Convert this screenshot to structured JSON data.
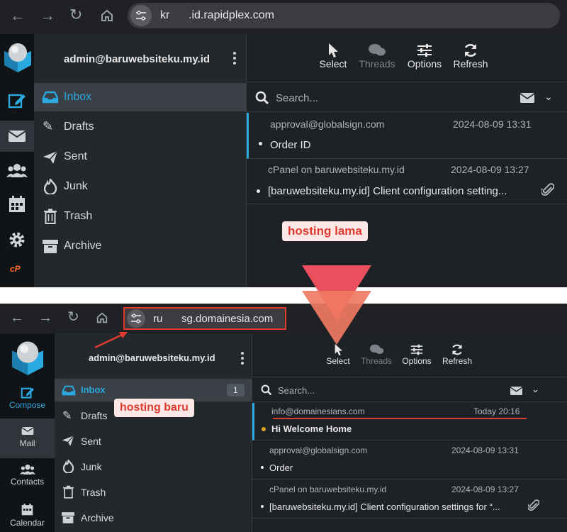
{
  "top": {
    "url_prefix": "kr",
    "url_host": ".id.rapidplex.com",
    "account": "admin@baruwebsiteku.my.id",
    "toolbar": [
      "Select",
      "Threads",
      "Options",
      "Refresh"
    ],
    "folders": [
      "Inbox",
      "Drafts",
      "Sent",
      "Junk",
      "Trash",
      "Archive"
    ],
    "search_placeholder": "Search...",
    "messages": [
      {
        "from": "approval@globalsign.com",
        "date": "2024-08-09 13:31",
        "subject": "Order ID"
      },
      {
        "from": "cPanel on baruwebsiteku.my.id",
        "date": "2024-08-09 13:27",
        "subject": "[baruwebsiteku.my.id] Client configuration setting..."
      }
    ],
    "label": "hosting lama",
    "cpanel_logo": "cP"
  },
  "bottom": {
    "url_prefix": "ru",
    "url_host": "sg.domainesia.com",
    "account": "admin@baruwebsiteku.my.id",
    "toolbar": [
      "Select",
      "Threads",
      "Options",
      "Refresh"
    ],
    "rail": [
      "Compose",
      "Mail",
      "Contacts",
      "Calendar"
    ],
    "folders": [
      "Inbox",
      "Drafts",
      "Sent",
      "Junk",
      "Trash",
      "Archive"
    ],
    "inbox_count": "1",
    "search_placeholder": "Search...",
    "messages": [
      {
        "from": "info@domainesians.com",
        "date": "Today 20:16",
        "subject": "Hi Welcome Home"
      },
      {
        "from": "approval@globalsign.com",
        "date": "2024-08-09 13:31",
        "subject": "Order"
      },
      {
        "from": "cPanel on baruwebsiteku.my.id",
        "date": "2024-08-09 13:27",
        "subject": "[baruwebsiteku.my.id] Client configuration settings for “..."
      }
    ],
    "label": "hosting baru"
  },
  "colors": {
    "accent": "#2aa8e0",
    "highlight": "#e03a2e",
    "arrow": "#e94f5c",
    "unread_dot": "#e0a020"
  },
  "icons": [
    "back-arrow-icon",
    "forward-arrow-icon",
    "reload-icon",
    "home-icon",
    "site-settings-icon",
    "down-arrow-icon"
  ]
}
